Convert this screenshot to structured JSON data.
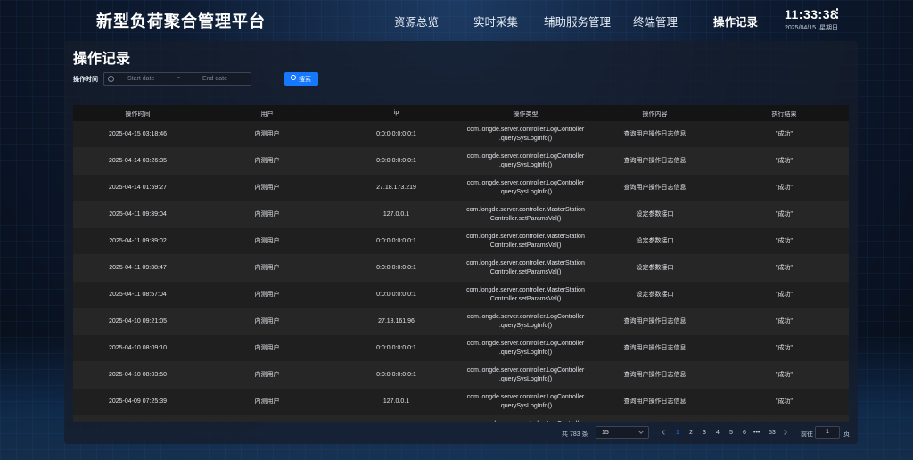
{
  "header": {
    "title": "新型负荷聚合管理平台",
    "nav": [
      "资源总览",
      "实时采集",
      "辅助服务管理",
      "终端管理",
      "操作记录"
    ],
    "active_nav": "操作记录",
    "clock": {
      "time": "11:33:38",
      "date": "2025/04/15",
      "weekday": "星期日"
    }
  },
  "page": {
    "title": "操作记录",
    "filter_label": "操作时间",
    "start_placeholder": "Start date",
    "range_sep": "~",
    "end_placeholder": "End date",
    "search_label": "搜索"
  },
  "table": {
    "columns": [
      "操作时间",
      "用户",
      "ip",
      "操作类型",
      "操作内容",
      "执行结果"
    ],
    "rows": [
      [
        "2025-04-15 03:18:46",
        "内测用户",
        "0:0:0:0:0:0:0:1",
        "com.longde.server.controller.LogController",
        ".querySysLogInfo()",
        "查询用户操作日志信息",
        "\"成功\""
      ],
      [
        "2025-04-14 03:26:35",
        "内测用户",
        "0:0:0:0:0:0:0:1",
        "com.longde.server.controller.LogController",
        ".querySysLogInfo()",
        "查询用户操作日志信息",
        "\"成功\""
      ],
      [
        "2025-04-14 01:59:27",
        "内测用户",
        "27.18.173.219",
        "com.longde.server.controller.LogController",
        ".querySysLogInfo()",
        "查询用户操作日志信息",
        "\"成功\""
      ],
      [
        "2025-04-11 09:39:04",
        "内测用户",
        "127.0.0.1",
        "com.longde.server.controller.MasterStation",
        "Controller.setParamsVal()",
        "设定参数接口",
        "\"成功\""
      ],
      [
        "2025-04-11 09:39:02",
        "内测用户",
        "0:0:0:0:0:0:0:1",
        "com.longde.server.controller.MasterStation",
        "Controller.setParamsVal()",
        "设定参数接口",
        "\"成功\""
      ],
      [
        "2025-04-11 09:38:47",
        "内测用户",
        "0:0:0:0:0:0:0:1",
        "com.longde.server.controller.MasterStation",
        "Controller.setParamsVal()",
        "设定参数接口",
        "\"成功\""
      ],
      [
        "2025-04-11 08:57:04",
        "内测用户",
        "0:0:0:0:0:0:0:1",
        "com.longde.server.controller.MasterStation",
        "Controller.setParamsVal()",
        "设定参数接口",
        "\"成功\""
      ],
      [
        "2025-04-10 09:21:05",
        "内测用户",
        "27.18.161.96",
        "com.longde.server.controller.LogController",
        ".querySysLogInfo()",
        "查询用户操作日志信息",
        "\"成功\""
      ],
      [
        "2025-04-10 08:09:10",
        "内测用户",
        "0:0:0:0:0:0:0:1",
        "com.longde.server.controller.LogController",
        ".querySysLogInfo()",
        "查询用户操作日志信息",
        "\"成功\""
      ],
      [
        "2025-04-10 08:03:50",
        "内测用户",
        "0:0:0:0:0:0:0:1",
        "com.longde.server.controller.LogController",
        ".querySysLogInfo()",
        "查询用户操作日志信息",
        "\"成功\""
      ],
      [
        "2025-04-09 07:25:39",
        "内测用户",
        "127.0.0.1",
        "com.longde.server.controller.LogController",
        ".querySysLogInfo()",
        "查询用户操作日志信息",
        "\"成功\""
      ],
      [
        "",
        "",
        "",
        "com.longde.server.controller.LogController",
        "",
        "",
        ""
      ]
    ]
  },
  "pagination": {
    "total": "共 783 条",
    "page_size": "15",
    "pages": [
      "1",
      "2",
      "3",
      "4",
      "5",
      "6",
      "•••",
      "53"
    ],
    "current": "1",
    "goto_label": "前往",
    "goto_value": "1",
    "goto_unit": "页"
  }
}
